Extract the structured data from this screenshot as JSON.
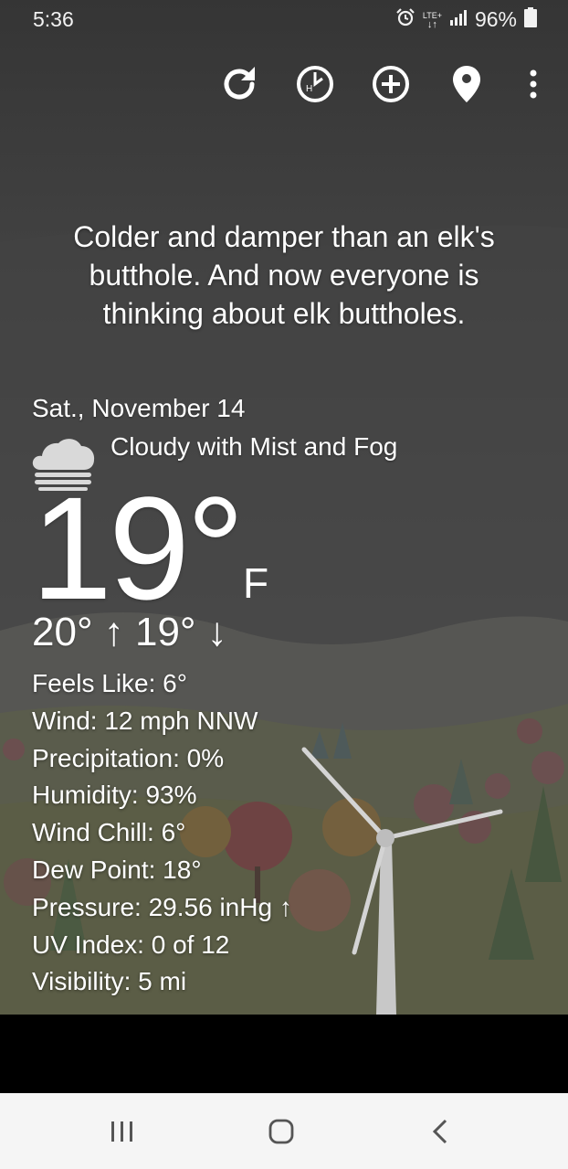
{
  "status_bar": {
    "time": "5:36",
    "network": "LTE+",
    "battery": "96%",
    "icons": [
      "alarm-icon",
      "lte-icon",
      "signal-icon",
      "battery-icon"
    ]
  },
  "toolbar": {
    "buttons": [
      "refresh-icon",
      "history-icon",
      "add-location-icon",
      "location-pin-icon",
      "more-vert-icon"
    ]
  },
  "headline": "Colder and damper than an elk's butthole. And now everyone is thinking about elk buttholes.",
  "weather": {
    "date": "Sat., November 14",
    "condition": "Cloudy with Mist and Fog",
    "condition_icon": "cloud-fog-icon",
    "temperature": "19°",
    "unit": "F",
    "hilo": "20° ↑ 19° ↓",
    "details": [
      "Feels Like: 6°",
      "Wind: 12 mph NNW",
      "Precipitation: 0%",
      "Humidity: 93%",
      "Wind Chill: 6°",
      "Dew Point: 18°",
      "Pressure: 29.56 inHg ↑",
      "UV Index: 0 of 12",
      "Visibility: 5 mi"
    ]
  },
  "navigation": {
    "buttons": [
      "recents-icon",
      "home-icon",
      "back-icon"
    ]
  },
  "colors": {
    "text": "#ffffff",
    "navbar_bg": "#f5f5f5",
    "nav_icon": "#555555"
  }
}
